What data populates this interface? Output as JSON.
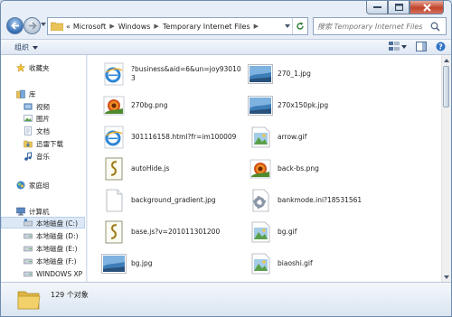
{
  "address": {
    "prefix": "«",
    "crumbs": [
      "Microsoft",
      "Windows",
      "Temporary Internet Files"
    ]
  },
  "search": {
    "placeholder": "搜索 Temporary Internet Files"
  },
  "toolbar": {
    "organize_label": "组织"
  },
  "nav": {
    "favorites": "收藏夹",
    "libraries": "库",
    "library_items": [
      "视频",
      "图片",
      "文档",
      "迅雷下载",
      "音乐"
    ],
    "homegroup": "家庭组",
    "computer": "计算机",
    "drives": [
      "本地磁盘 (C:)",
      "本地磁盘 (D:)",
      "本地磁盘 (E:)",
      "本地磁盘 (F:)",
      "WINDOWS XP"
    ]
  },
  "files": {
    "left": [
      {
        "name_lines": [
          "?business&aid=6&un=joy93010",
          "3"
        ],
        "icon": "ie-html-icon"
      },
      {
        "name_lines": [
          "270bg.png"
        ],
        "icon": "png-image-icon"
      },
      {
        "name_lines": [
          "301116158.html?fr=im100009"
        ],
        "icon": "ie-html-icon"
      },
      {
        "name_lines": [
          "autoHide.js"
        ],
        "icon": "script-icon"
      },
      {
        "name_lines": [
          "background_gradient.jpg"
        ],
        "icon": "blank-file-icon"
      },
      {
        "name_lines": [
          "base.js?v=201011301200"
        ],
        "icon": "script-icon"
      },
      {
        "name_lines": [
          "bg.jpg"
        ],
        "icon": "landscape-image-icon"
      }
    ],
    "right": [
      {
        "name_lines": [
          "270_1.jpg"
        ],
        "icon": "landscape-image-icon"
      },
      {
        "name_lines": [
          "270x150pk.jpg"
        ],
        "icon": "landscape-image-icon"
      },
      {
        "name_lines": [
          "arrow.gif"
        ],
        "icon": "gif-image-icon"
      },
      {
        "name_lines": [
          "back-bs.png"
        ],
        "icon": "png-image-icon"
      },
      {
        "name_lines": [
          "bankmode.ini?18531561"
        ],
        "icon": "config-file-icon"
      },
      {
        "name_lines": [
          "bg.gif"
        ],
        "icon": "gif-image-icon"
      },
      {
        "name_lines": [
          "biaoshi.gif"
        ],
        "icon": "gif-image-icon"
      }
    ]
  },
  "status": {
    "count": "129 个对象"
  }
}
